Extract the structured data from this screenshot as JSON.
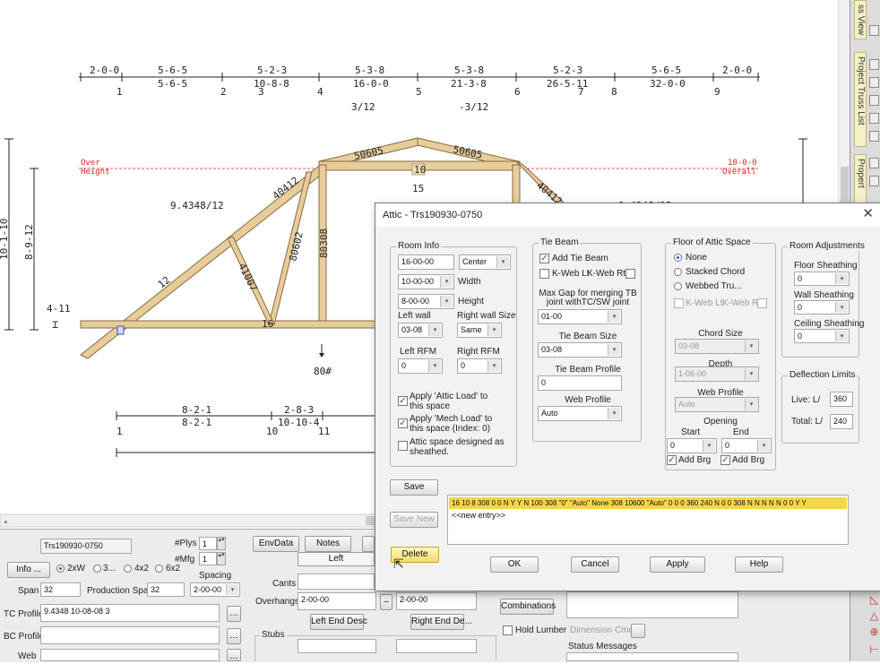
{
  "drawing": {
    "top_dims": [
      {
        "top": "2-0-0",
        "bottom": ""
      },
      {
        "top": "5-6-5",
        "bottom": "5-6-5"
      },
      {
        "top": "5-2-3",
        "bottom": "10-8-8"
      },
      {
        "top": "5-3-8",
        "bottom": "16-0-0"
      },
      {
        "top": "5-3-8",
        "bottom": "21-3-8"
      },
      {
        "top": "5-2-3",
        "bottom": "26-5-11"
      },
      {
        "top": "5-6-5",
        "bottom": "32-0-0"
      },
      {
        "top": "2-0-0",
        "bottom": ""
      }
    ],
    "top_panel_points": [
      "1",
      "2",
      "3",
      "4",
      "5",
      "6",
      "7",
      "8",
      "9"
    ],
    "pitch_left": "3/12",
    "pitch_right": "-3/12",
    "over_height_label": [
      "Over",
      "Height"
    ],
    "overall_label": [
      "10-0-0",
      "Overall"
    ],
    "side_pitch": "9.4348/12",
    "side_pitch_right": "9.4348/12",
    "left_dim_outer": "10-1-10",
    "left_dim_inner": "8-9-12",
    "left_dim_small": "4-11",
    "center_label": "15",
    "center_plate": "10",
    "members": [
      "50605",
      "50605",
      "40412",
      "40412",
      "80602",
      "80308",
      "41007",
      "12"
    ],
    "joint_label": "16",
    "load_label": "80#",
    "bottom_dims": [
      {
        "top": "8-2-1",
        "bottom": "8-2-1"
      },
      {
        "top": "2-8-3",
        "bottom": "10-10-4"
      }
    ],
    "bottom_points": [
      "1",
      "10",
      "11"
    ]
  },
  "sidebar": {
    "tabs": [
      "ss View",
      "Project Truss List",
      "Propert"
    ],
    "red_icons": [
      "◺",
      "△",
      "⊕",
      "⊢"
    ]
  },
  "bottom_panel": {
    "truss_name": "Trs190930-0750",
    "plys_label": "#Plys",
    "plys_value": "1",
    "mfg_label": "#Mfg",
    "mfg_value": "1",
    "info_button": "Info ...",
    "radios": [
      "2xW",
      "3...",
      "4x2",
      "6x2"
    ],
    "spacing_label": "Spacing",
    "spacing_value": "2-00-00",
    "span_label": "Span",
    "span_value": "32",
    "prod_span_label": "Production Span",
    "prod_span_value": "32",
    "tc_profile_label": "TC Profile",
    "tc_profile_value": "9.4348 10-08-08 3",
    "bc_profile_label": "BC Profile",
    "web_label": "Web",
    "envdata_button": "EnvData",
    "notes_button": "Notes",
    "left_tab": "Left",
    "cants_label": "Cants",
    "overhangs_label": "Overhangs",
    "overhang_left": "2-00-00",
    "overhang_right": "2-00-00",
    "left_end_desc": "Left End Desc",
    "right_end_desc": "Right End De...",
    "stubs_label": "Stubs",
    "combinations_button": "Combinations",
    "hold_lumber": "Hold Lumber",
    "dimension_cmds": "Dimension Cmds",
    "status_messages": "Status Messages"
  },
  "dialog": {
    "title": "Attic - Trs190930-0750",
    "room_info": {
      "title": "Room Info",
      "height_val": "16-00-00",
      "position": "Center",
      "width_val": "10-00-00",
      "width_label": "Width",
      "height2_val": "8-00-00",
      "height_label": "Height",
      "left_wall_label": "Left wall",
      "right_wall_label": "Right wall Size",
      "left_wall_val": "03-08",
      "right_wall_val": "Same",
      "left_rfm_label": "Left RFM",
      "right_rfm_label": "Right RFM",
      "left_rfm_val": "0",
      "right_rfm_val": "0",
      "chk_attic_load": "Apply 'Attic Load' to this space",
      "chk_mech_load": "Apply 'Mech Load' to this space (Index: 0)",
      "chk_sheathed": "Attic space designed as sheathed."
    },
    "tie_beam": {
      "title": "Tie Beam",
      "add_tie_beam": "Add Tie Beam",
      "kweb_lt": "K-Web Lt",
      "kweb_rt": "K-Web Rt",
      "max_gap_label": "Max Gap for merging TB joint withTC/SW joint",
      "max_gap_val": "01-00",
      "size_label": "Tie Beam Size",
      "size_val": "03-08",
      "profile_label": "Tie Beam Profile",
      "profile_val": "0",
      "web_profile_label": "Web Profile",
      "web_profile_val": "Auto"
    },
    "floor": {
      "title": "Floor of Attic Space",
      "opt_none": "None",
      "opt_stacked": "Stacked Chord",
      "opt_webbed": "Webbed Tru...",
      "kweb_lt": "K-Web Lt",
      "kweb_rt": "K-Web Rt",
      "chord_size_label": "Chord Size",
      "chord_size_val": "03-08",
      "depth_label": "Depth",
      "depth_val": "1-06-00",
      "web_profile_label": "Web Profile",
      "web_profile_val": "Auto",
      "opening_label": "Opening",
      "start_label": "Start",
      "end_label": "End",
      "start_val": "0",
      "end_val": "0",
      "add_brg_1": "Add Brg",
      "add_brg_2": "Add Brg"
    },
    "room_adj": {
      "title": "Room Adjustments",
      "floor_label": "Floor Sheathing",
      "floor_val": "0",
      "wall_label": "Wall Sheathing",
      "wall_val": "0",
      "ceiling_label": "Ceiling Sheathing",
      "ceiling_val": "0"
    },
    "deflection": {
      "title": "Deflection Limits",
      "live_label": "Live: L/",
      "live_val": "360",
      "total_label": "Total: L/",
      "total_val": "240"
    },
    "save_button": "Save",
    "save_new_button": "Save New",
    "delete_button": "Delete",
    "list_selected": "16 10 8 308 0 0 N Y Y N 100 308 \"0\" \"Auto\" None 308 10600 \"Auto\" 0 0 0 360 240 N 0 0 308 N N N N N 0 0 Y Y",
    "list_new": "<<new entry>>",
    "ok_button": "OK",
    "cancel_button": "Cancel",
    "apply_button": "Apply",
    "help_button": "Help"
  }
}
